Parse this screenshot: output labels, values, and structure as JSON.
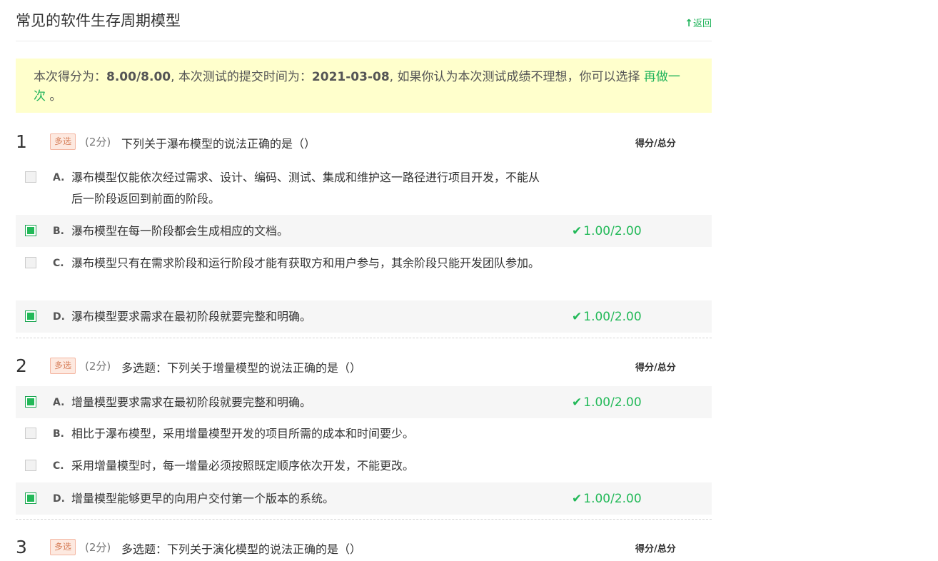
{
  "page": {
    "title": "常见的软件生存周期模型",
    "back_label": "返回"
  },
  "score_box": {
    "prefix": "本次得分为：",
    "score": "8.00/8.00",
    "middle": ", 本次测试的提交时间为：",
    "date": "2021-03-08",
    "suffix": ", 如果你认为本次测试成绩不理想，你可以选择",
    "retry_label": "再做一次",
    "end": "。"
  },
  "questions": [
    {
      "number": "1",
      "type": "多选",
      "points": "(2分)",
      "text": "下列关于瀑布模型的说法正确的是（）",
      "score_header": "得分/总分",
      "options": [
        {
          "letter": "A.",
          "text": "瀑布模型仅能依次经过需求、设计、编码、测试、集成和维护这一路径进行项目开发，不能从后一阶段返回到前面的阶段。",
          "checked": false,
          "result": ""
        },
        {
          "letter": "B.",
          "text": "瀑布模型在每一阶段都会生成相应的文档。",
          "checked": true,
          "result": "1.00/2.00"
        },
        {
          "letter": "C.",
          "text": "瀑布模型只有在需求阶段和运行阶段才能有获取方和用户参与，其余阶段只能开发团队参加。",
          "checked": false,
          "result": ""
        },
        {
          "letter": "D.",
          "text": "瀑布模型要求需求在最初阶段就要完整和明确。",
          "checked": true,
          "result": "1.00/2.00"
        }
      ]
    },
    {
      "number": "2",
      "type": "多选",
      "points": "(2分)",
      "text": "多选题：下列关于增量模型的说法正确的是（）",
      "score_header": "得分/总分",
      "options": [
        {
          "letter": "A.",
          "text": "增量模型要求需求在最初阶段就要完整和明确。",
          "checked": true,
          "result": "1.00/2.00"
        },
        {
          "letter": "B.",
          "text": "相比于瀑布模型，采用增量模型开发的项目所需的成本和时间要少。",
          "checked": false,
          "result": ""
        },
        {
          "letter": "C.",
          "text": "采用增量模型时，每一增量必须按照既定顺序依次开发，不能更改。",
          "checked": false,
          "result": ""
        },
        {
          "letter": "D.",
          "text": "增量模型能够更早的向用户交付第一个版本的系统。",
          "checked": true,
          "result": "1.00/2.00"
        }
      ]
    },
    {
      "number": "3",
      "type": "多选",
      "points": "(2分)",
      "text": "多选题：下列关于演化模型的说法正确的是（）",
      "score_header": "得分/总分",
      "options": []
    }
  ],
  "colors": {
    "accent_green": "#22b958",
    "score_bg": "#ffffcc",
    "badge_bg": "#fde9e0",
    "badge_text": "#d7805b"
  },
  "icons": {
    "back": "arrow-up-icon",
    "correct": "checkmark-icon"
  }
}
